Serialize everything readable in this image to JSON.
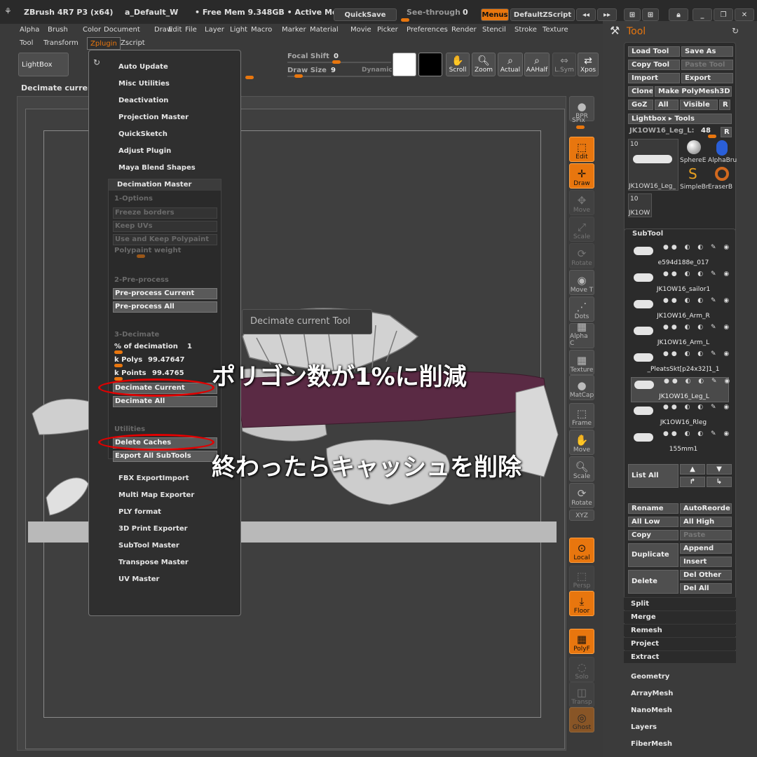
{
  "titlebar": {
    "app": "ZBrush 4R7 P3 (x64)",
    "document": "a_Default_W",
    "free_mem": "• Free Mem 9.348GB • Active Me",
    "quicksave": "QuickSave",
    "see_through": "See-through",
    "see_through_value": "0",
    "menus": "Menus",
    "default_zscript": "DefaultZScript"
  },
  "menubar": {
    "items": [
      "Alpha",
      "Brush",
      "Color",
      "Document",
      "Draw",
      "Edit",
      "File",
      "Layer",
      "Light",
      "Macro",
      "Marker",
      "Material",
      "Movie",
      "Picker",
      "Preferences",
      "Render",
      "Stencil",
      "Stroke",
      "Texture"
    ],
    "row2": [
      "Tool",
      "Transform",
      "Zplugin",
      "Zscript"
    ]
  },
  "shelf": {
    "lightbox": "LightBox",
    "focal_shift_label": "Focal Shift",
    "focal_shift_value": "0",
    "draw_size_label": "Draw Size",
    "draw_size_value": "9",
    "dynamic": "Dynamic",
    "buttons": [
      "Scroll",
      "Zoom",
      "Actual",
      "AAHalf",
      "L.Sym",
      "Xpos"
    ]
  },
  "status_text": "Decimate current Tool",
  "zplugin_menu": {
    "items_top": [
      "Auto Update",
      "Misc Utilities",
      "Deactivation",
      "Projection Master",
      "QuickSketch",
      "Adjust Plugin",
      "Maya Blend Shapes"
    ],
    "decimation_master": {
      "title": "Decimation Master",
      "options_header": "1-Options",
      "freeze_borders": "Freeze borders",
      "keep_uvs": "Keep UVs",
      "use_keep_polypaint": "Use and Keep Polypaint",
      "polypaint_weight": "Polypaint weight",
      "preprocess_header": "2-Pre-process",
      "preprocess_current": "Pre-process Current",
      "preprocess_all": "Pre-process All",
      "decimate_header": "3-Decimate",
      "pct_label": "% of decimation",
      "pct_value": "1",
      "kpolys_label": "k Polys",
      "kpolys_value": "99.47647",
      "kpoints_label": "k Points",
      "kpoints_value": "99.4765",
      "decimate_current": "Decimate Current",
      "decimate_all": "Decimate All",
      "utilities_header": "Utilities",
      "delete_caches": "Delete Caches",
      "export_all_subtools": "Export All SubTools"
    },
    "items_bottom": [
      "FBX ExportImport",
      "Multi Map Exporter",
      "PLY format",
      "3D Print Exporter",
      "SubTool Master",
      "Transpose Master",
      "UV Master"
    ]
  },
  "tooltip": "Decimate current Tool",
  "annotations": {
    "line1": "ポリゴン数が1%に削減",
    "line2": "終わったらキャッシュを削除"
  },
  "right_toolbar": [
    "BPR",
    "SPix",
    "Edit",
    "Draw",
    "Move",
    "Scale",
    "Rotate",
    "Move T",
    "Dots",
    "Alpha C",
    "Texture",
    "MatCap",
    "Frame",
    "Move",
    "Scale",
    "Rotate",
    "XYZ",
    "Local",
    "Persp",
    "Floor",
    "PolyF",
    "Solo",
    "Transp",
    "Ghost"
  ],
  "tool_panel": {
    "title": "Tool",
    "buttons": [
      "Load Tool",
      "Save As",
      "Copy Tool",
      "Paste Tool",
      "Import",
      "Export",
      "Clone",
      "Make PolyMesh3D",
      "GoZ",
      "All",
      "Visible",
      "R",
      "Lightbox ▸ Tools"
    ],
    "current_tool": "JK1OW16_Leg_L:",
    "current_tool_value": "48",
    "thumbs": [
      "JK1OW16_Leg_",
      "SphereE",
      "AlphaBru",
      "SimpleBr",
      "EraserB",
      "JK1OW"
    ],
    "subtool_header": "SubTool",
    "subtools": [
      "e594d188e_017",
      "JK1OW16_sailor1",
      "JK1OW16_Arm_R",
      "JK1OW16_Arm_L",
      "_PleatsSkt[p24x32]1_1",
      "JK1OW16_Leg_L",
      "JK1OW16_Rleg",
      "155mm1"
    ],
    "list_all": "List All",
    "rename": "Rename",
    "auto_reorder": "AutoReorde",
    "all_low": "All Low",
    "all_high": "All High",
    "copy": "Copy",
    "paste": "Paste",
    "duplicate": "Duplicate",
    "append": "Append",
    "insert": "Insert",
    "delete": "Delete",
    "del_other": "Del Other",
    "del_all": "Del All",
    "subsections": [
      "Split",
      "Merge",
      "Remesh",
      "Project",
      "Extract"
    ],
    "sections": [
      "Geometry",
      "ArrayMesh",
      "NanoMesh",
      "Layers",
      "FiberMesh"
    ]
  },
  "colors": {
    "accent": "#e8760e",
    "annotation_red": "#e00000"
  }
}
